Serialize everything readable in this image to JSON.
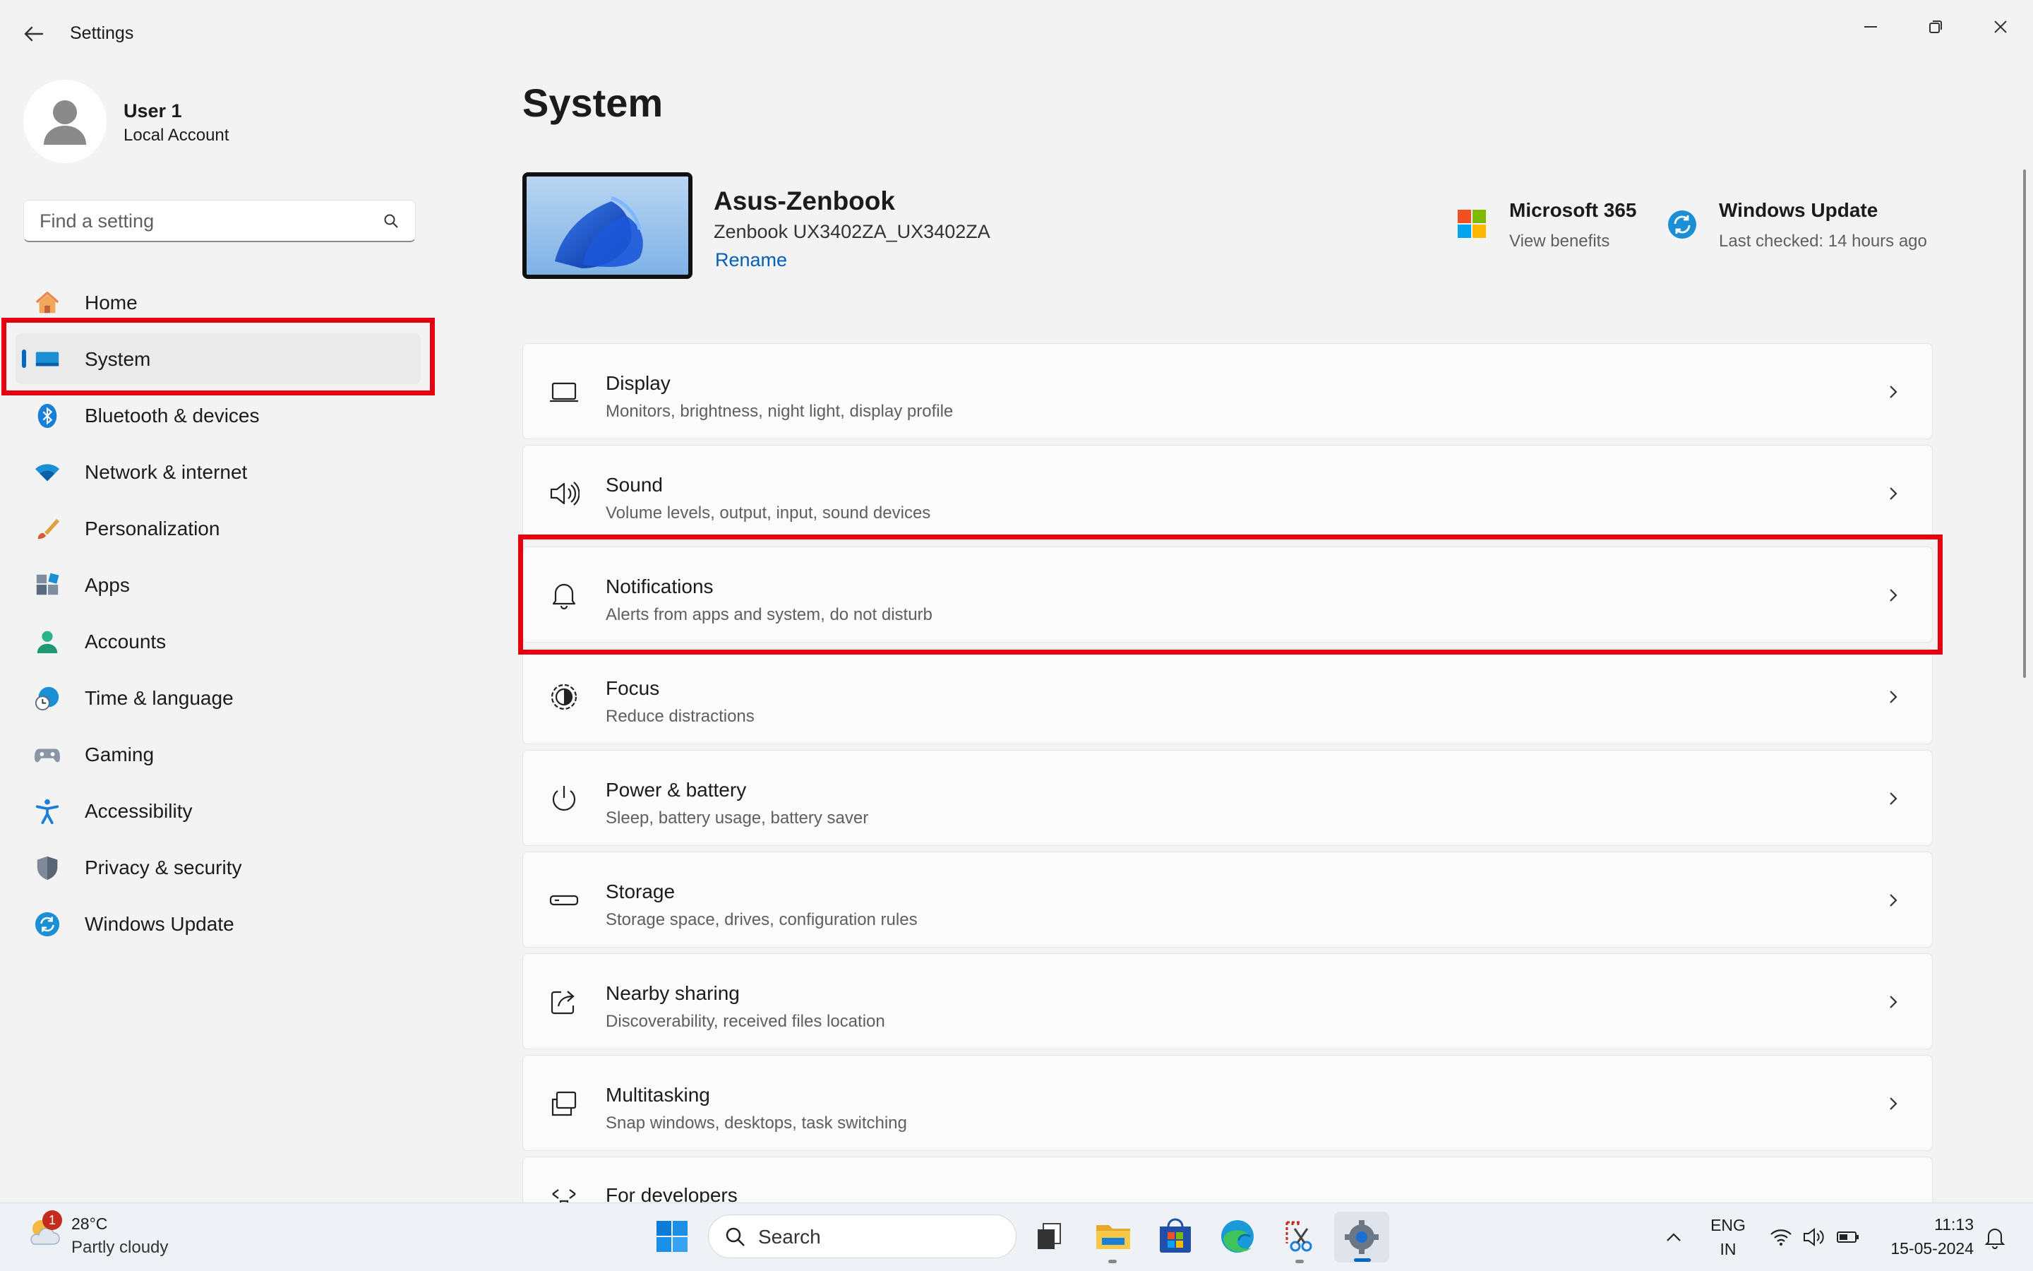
{
  "window": {
    "title": "Settings"
  },
  "user": {
    "name": "User 1",
    "account_type": "Local Account"
  },
  "search": {
    "placeholder": "Find a setting"
  },
  "sidebar": {
    "items": [
      {
        "label": "Home",
        "icon": "home-icon"
      },
      {
        "label": "System",
        "icon": "system-icon",
        "active": true
      },
      {
        "label": "Bluetooth & devices",
        "icon": "bluetooth-icon"
      },
      {
        "label": "Network & internet",
        "icon": "wifi-icon"
      },
      {
        "label": "Personalization",
        "icon": "brush-icon"
      },
      {
        "label": "Apps",
        "icon": "apps-icon"
      },
      {
        "label": "Accounts",
        "icon": "accounts-icon"
      },
      {
        "label": "Time & language",
        "icon": "clock-globe-icon"
      },
      {
        "label": "Gaming",
        "icon": "gamepad-icon"
      },
      {
        "label": "Accessibility",
        "icon": "accessibility-icon"
      },
      {
        "label": "Privacy & security",
        "icon": "shield-icon"
      },
      {
        "label": "Windows Update",
        "icon": "update-icon"
      }
    ]
  },
  "main": {
    "title": "System",
    "device": {
      "name": "Asus-Zenbook",
      "model": "Zenbook UX3402ZA_UX3402ZA",
      "rename_label": "Rename"
    },
    "quick": [
      {
        "title": "Microsoft 365",
        "subtitle": "View benefits",
        "icon": "microsoft-365-icon"
      },
      {
        "title": "Windows Update",
        "subtitle": "Last checked: 14 hours ago",
        "icon": "windows-update-icon"
      }
    ],
    "cards": [
      {
        "title": "Display",
        "subtitle": "Monitors, brightness, night light, display profile",
        "icon": "display-icon"
      },
      {
        "title": "Sound",
        "subtitle": "Volume levels, output, input, sound devices",
        "icon": "speaker-icon"
      },
      {
        "title": "Notifications",
        "subtitle": "Alerts from apps and system, do not disturb",
        "icon": "bell-icon"
      },
      {
        "title": "Focus",
        "subtitle": "Reduce distractions",
        "icon": "focus-icon"
      },
      {
        "title": "Power & battery",
        "subtitle": "Sleep, battery usage, battery saver",
        "icon": "power-icon"
      },
      {
        "title": "Storage",
        "subtitle": "Storage space, drives, configuration rules",
        "icon": "storage-icon"
      },
      {
        "title": "Nearby sharing",
        "subtitle": "Discoverability, received files location",
        "icon": "share-icon"
      },
      {
        "title": "Multitasking",
        "subtitle": "Snap windows, desktops, task switching",
        "icon": "multitasking-icon"
      },
      {
        "title": "For developers",
        "subtitle": "",
        "icon": "developer-icon"
      }
    ]
  },
  "taskbar": {
    "weather": {
      "temp": "28°C",
      "condition": "Partly cloudy",
      "badge": "1"
    },
    "search_label": "Search",
    "lang_line1": "ENG",
    "lang_line2": "IN",
    "time": "11:13",
    "date": "15-05-2024"
  },
  "colors": {
    "accent": "#0067c0",
    "link": "#005fb8",
    "highlight_border": "#e5000f",
    "background": "#f3f3f3"
  }
}
